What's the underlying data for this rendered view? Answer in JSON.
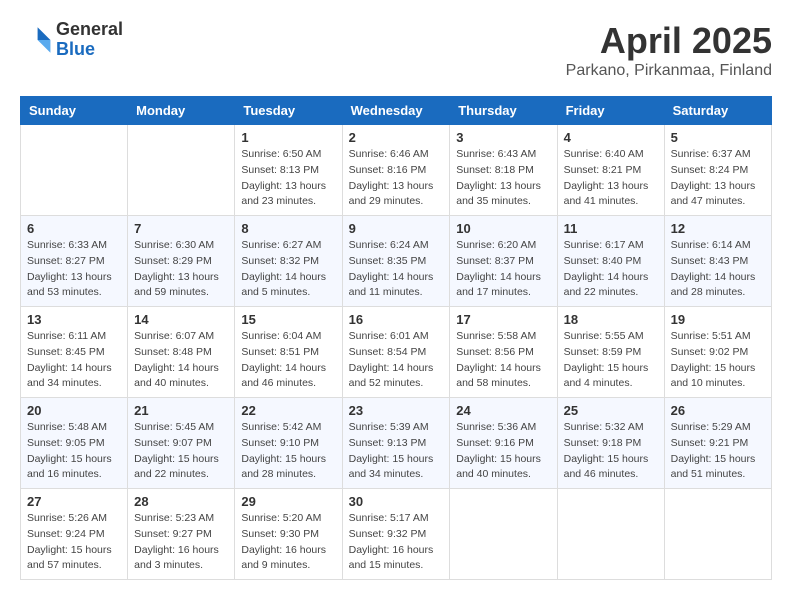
{
  "logo": {
    "general": "General",
    "blue": "Blue"
  },
  "title": "April 2025",
  "location": "Parkano, Pirkanmaa, Finland",
  "headers": [
    "Sunday",
    "Monday",
    "Tuesday",
    "Wednesday",
    "Thursday",
    "Friday",
    "Saturday"
  ],
  "weeks": [
    [
      {
        "day": "",
        "info": ""
      },
      {
        "day": "",
        "info": ""
      },
      {
        "day": "1",
        "info": "Sunrise: 6:50 AM\nSunset: 8:13 PM\nDaylight: 13 hours\nand 23 minutes."
      },
      {
        "day": "2",
        "info": "Sunrise: 6:46 AM\nSunset: 8:16 PM\nDaylight: 13 hours\nand 29 minutes."
      },
      {
        "day": "3",
        "info": "Sunrise: 6:43 AM\nSunset: 8:18 PM\nDaylight: 13 hours\nand 35 minutes."
      },
      {
        "day": "4",
        "info": "Sunrise: 6:40 AM\nSunset: 8:21 PM\nDaylight: 13 hours\nand 41 minutes."
      },
      {
        "day": "5",
        "info": "Sunrise: 6:37 AM\nSunset: 8:24 PM\nDaylight: 13 hours\nand 47 minutes."
      }
    ],
    [
      {
        "day": "6",
        "info": "Sunrise: 6:33 AM\nSunset: 8:27 PM\nDaylight: 13 hours\nand 53 minutes."
      },
      {
        "day": "7",
        "info": "Sunrise: 6:30 AM\nSunset: 8:29 PM\nDaylight: 13 hours\nand 59 minutes."
      },
      {
        "day": "8",
        "info": "Sunrise: 6:27 AM\nSunset: 8:32 PM\nDaylight: 14 hours\nand 5 minutes."
      },
      {
        "day": "9",
        "info": "Sunrise: 6:24 AM\nSunset: 8:35 PM\nDaylight: 14 hours\nand 11 minutes."
      },
      {
        "day": "10",
        "info": "Sunrise: 6:20 AM\nSunset: 8:37 PM\nDaylight: 14 hours\nand 17 minutes."
      },
      {
        "day": "11",
        "info": "Sunrise: 6:17 AM\nSunset: 8:40 PM\nDaylight: 14 hours\nand 22 minutes."
      },
      {
        "day": "12",
        "info": "Sunrise: 6:14 AM\nSunset: 8:43 PM\nDaylight: 14 hours\nand 28 minutes."
      }
    ],
    [
      {
        "day": "13",
        "info": "Sunrise: 6:11 AM\nSunset: 8:45 PM\nDaylight: 14 hours\nand 34 minutes."
      },
      {
        "day": "14",
        "info": "Sunrise: 6:07 AM\nSunset: 8:48 PM\nDaylight: 14 hours\nand 40 minutes."
      },
      {
        "day": "15",
        "info": "Sunrise: 6:04 AM\nSunset: 8:51 PM\nDaylight: 14 hours\nand 46 minutes."
      },
      {
        "day": "16",
        "info": "Sunrise: 6:01 AM\nSunset: 8:54 PM\nDaylight: 14 hours\nand 52 minutes."
      },
      {
        "day": "17",
        "info": "Sunrise: 5:58 AM\nSunset: 8:56 PM\nDaylight: 14 hours\nand 58 minutes."
      },
      {
        "day": "18",
        "info": "Sunrise: 5:55 AM\nSunset: 8:59 PM\nDaylight: 15 hours\nand 4 minutes."
      },
      {
        "day": "19",
        "info": "Sunrise: 5:51 AM\nSunset: 9:02 PM\nDaylight: 15 hours\nand 10 minutes."
      }
    ],
    [
      {
        "day": "20",
        "info": "Sunrise: 5:48 AM\nSunset: 9:05 PM\nDaylight: 15 hours\nand 16 minutes."
      },
      {
        "day": "21",
        "info": "Sunrise: 5:45 AM\nSunset: 9:07 PM\nDaylight: 15 hours\nand 22 minutes."
      },
      {
        "day": "22",
        "info": "Sunrise: 5:42 AM\nSunset: 9:10 PM\nDaylight: 15 hours\nand 28 minutes."
      },
      {
        "day": "23",
        "info": "Sunrise: 5:39 AM\nSunset: 9:13 PM\nDaylight: 15 hours\nand 34 minutes."
      },
      {
        "day": "24",
        "info": "Sunrise: 5:36 AM\nSunset: 9:16 PM\nDaylight: 15 hours\nand 40 minutes."
      },
      {
        "day": "25",
        "info": "Sunrise: 5:32 AM\nSunset: 9:18 PM\nDaylight: 15 hours\nand 46 minutes."
      },
      {
        "day": "26",
        "info": "Sunrise: 5:29 AM\nSunset: 9:21 PM\nDaylight: 15 hours\nand 51 minutes."
      }
    ],
    [
      {
        "day": "27",
        "info": "Sunrise: 5:26 AM\nSunset: 9:24 PM\nDaylight: 15 hours\nand 57 minutes."
      },
      {
        "day": "28",
        "info": "Sunrise: 5:23 AM\nSunset: 9:27 PM\nDaylight: 16 hours\nand 3 minutes."
      },
      {
        "day": "29",
        "info": "Sunrise: 5:20 AM\nSunset: 9:30 PM\nDaylight: 16 hours\nand 9 minutes."
      },
      {
        "day": "30",
        "info": "Sunrise: 5:17 AM\nSunset: 9:32 PM\nDaylight: 16 hours\nand 15 minutes."
      },
      {
        "day": "",
        "info": ""
      },
      {
        "day": "",
        "info": ""
      },
      {
        "day": "",
        "info": ""
      }
    ]
  ]
}
